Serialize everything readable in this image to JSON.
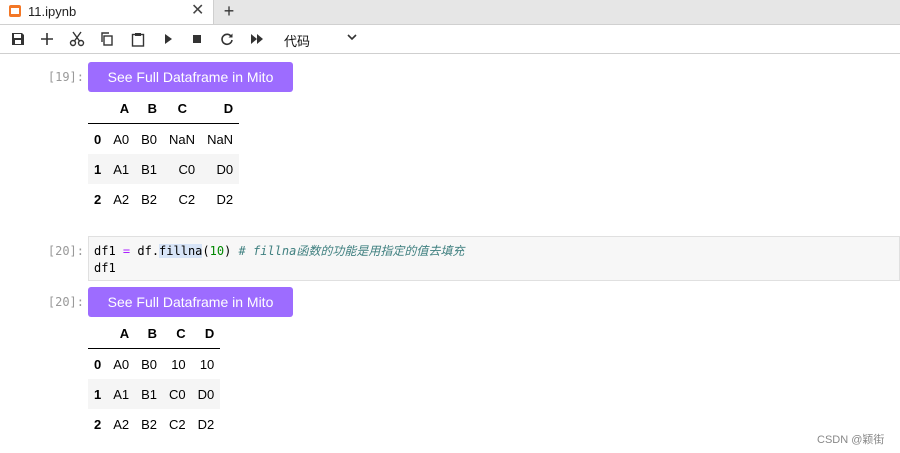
{
  "tab": {
    "title": "11.ipynb",
    "close": "✕",
    "new_tab": "+"
  },
  "toolbar": {
    "cell_type": "代码"
  },
  "cells": [
    {
      "prompt": "[19]:",
      "mito_button": "See Full Dataframe in Mito",
      "table": {
        "columns": [
          "",
          "A",
          "B",
          "C",
          "D"
        ],
        "rows": [
          [
            "0",
            "A0",
            "B0",
            "NaN",
            "NaN"
          ],
          [
            "1",
            "A1",
            "B1",
            "C0",
            "D0"
          ],
          [
            "2",
            "A2",
            "B2",
            "C2",
            "D2"
          ]
        ]
      }
    },
    {
      "prompt": "[20]:",
      "code": {
        "line1": {
          "var": "df1 ",
          "op": "=",
          "obj": " df.",
          "func": "fillna",
          "open": "(",
          "num": "10",
          "close": ") ",
          "comment": "# fillna函数的功能是用指定的值去填充"
        },
        "line2": "df1"
      }
    },
    {
      "prompt": "[20]:",
      "mito_button": "See Full Dataframe in Mito",
      "table": {
        "columns": [
          "",
          "A",
          "B",
          "C",
          "D"
        ],
        "rows": [
          [
            "0",
            "A0",
            "B0",
            "10",
            "10"
          ],
          [
            "1",
            "A1",
            "B1",
            "C0",
            "D0"
          ],
          [
            "2",
            "A2",
            "B2",
            "C2",
            "D2"
          ]
        ]
      }
    }
  ],
  "watermark": "CSDN @颖街"
}
